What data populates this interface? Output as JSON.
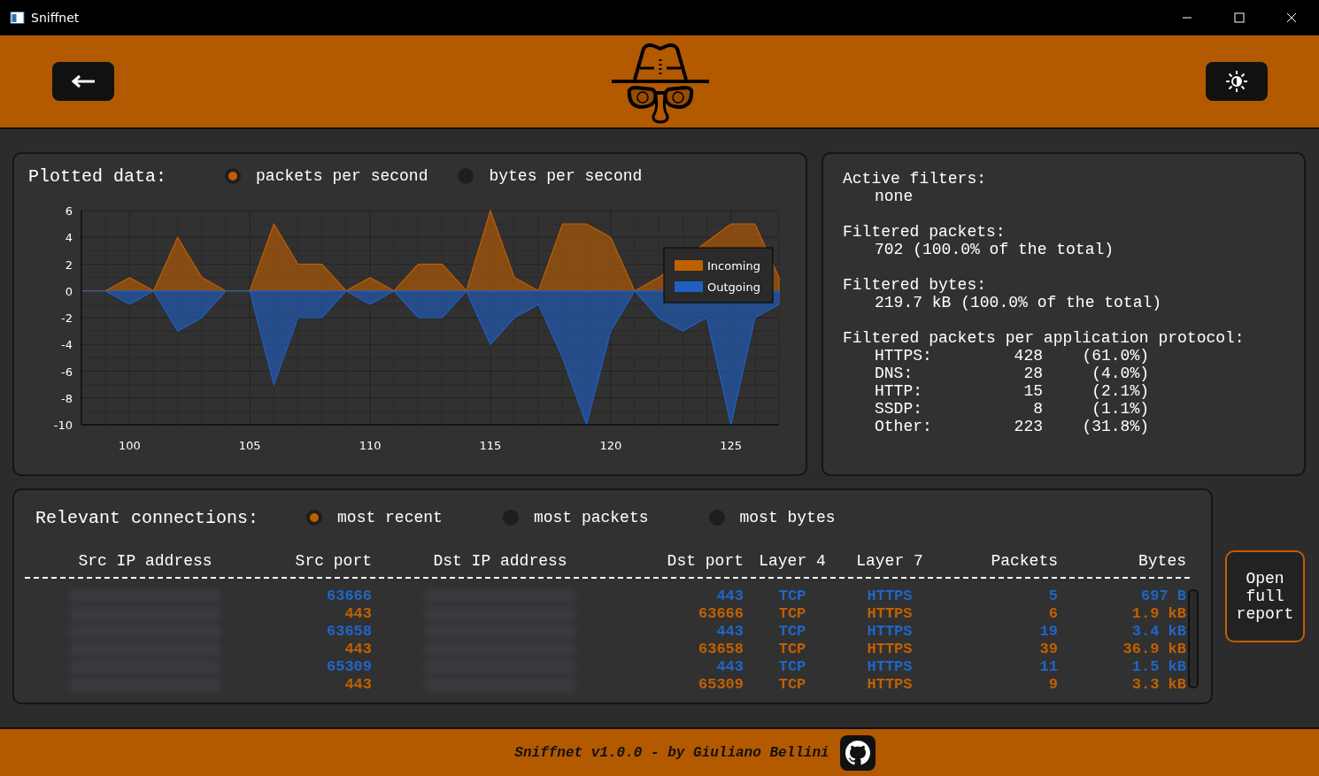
{
  "window": {
    "title": "Sniffnet"
  },
  "plot": {
    "title": "Plotted data:",
    "options": [
      {
        "label": "packets per second",
        "selected": true
      },
      {
        "label": "bytes per second",
        "selected": false
      }
    ],
    "chart_data": {
      "type": "area",
      "x": [
        98,
        99,
        100,
        101,
        102,
        103,
        104,
        105,
        106,
        107,
        108,
        109,
        110,
        111,
        112,
        113,
        114,
        115,
        116,
        117,
        118,
        119,
        120,
        121,
        122,
        123,
        124,
        125,
        126,
        127
      ],
      "series": [
        {
          "name": "Incoming",
          "color": "#c05f00",
          "values": [
            0,
            0,
            1,
            0,
            4,
            1,
            0,
            0,
            5,
            2,
            2,
            0,
            1,
            0,
            2,
            2,
            0,
            6,
            1,
            0,
            5,
            5,
            4,
            0,
            1,
            null,
            null,
            5,
            5,
            1
          ]
        },
        {
          "name": "Outgoing",
          "color": "#1f5fc4",
          "values": [
            0,
            0,
            -1,
            0,
            -3,
            -2,
            0,
            0,
            -7,
            -2,
            -2,
            0,
            -1,
            0,
            -2,
            -2,
            0,
            -4,
            -2,
            -1,
            -5,
            -10,
            -3,
            0,
            -2,
            -3,
            -2,
            -10,
            -2,
            -1
          ]
        }
      ],
      "xlim": [
        98,
        127
      ],
      "ylim": [
        -10,
        6
      ],
      "xticks": [
        100,
        105,
        110,
        115,
        120,
        125
      ],
      "yticks": [
        -10,
        -8,
        -6,
        -4,
        -2,
        0,
        2,
        4,
        6
      ],
      "grid": true,
      "legend": true
    }
  },
  "stats": {
    "filters_label": "Active filters:",
    "filters_value": "none",
    "packets_label": "Filtered packets:",
    "packets_value": "702 (100.0% of the total)",
    "bytes_label": "Filtered bytes:",
    "bytes_value": "219.7 kB (100.0% of the total)",
    "protocols_label": "Filtered packets per application protocol:",
    "protocols": [
      {
        "name": "HTTPS:",
        "count": "428",
        "share": "(61.0%)"
      },
      {
        "name": "DNS:",
        "count": "28",
        "share": "(4.0%)"
      },
      {
        "name": "HTTP:",
        "count": "15",
        "share": "(2.1%)"
      },
      {
        "name": "SSDP:",
        "count": "8",
        "share": "(1.1%)"
      },
      {
        "name": "Other:",
        "count": "223",
        "share": "(31.8%)"
      }
    ]
  },
  "connections": {
    "title": "Relevant connections:",
    "options": [
      {
        "label": "most recent",
        "selected": true
      },
      {
        "label": "most packets",
        "selected": false
      },
      {
        "label": "most bytes",
        "selected": false
      }
    ],
    "columns": [
      "Src IP address",
      "Src port",
      "Dst IP address",
      "Dst port",
      "Layer 4",
      "Layer 7",
      "Packets",
      "Bytes"
    ],
    "rows": [
      {
        "kind": "outgoing",
        "src_port": "63666",
        "dst_port": "443",
        "layer4": "TCP",
        "layer7": "HTTPS",
        "packets": "5",
        "bytes": "697 B"
      },
      {
        "kind": "incoming",
        "src_port": "443",
        "dst_port": "63666",
        "layer4": "TCP",
        "layer7": "HTTPS",
        "packets": "6",
        "bytes": "1.9 kB"
      },
      {
        "kind": "outgoing",
        "src_port": "63658",
        "dst_port": "443",
        "layer4": "TCP",
        "layer7": "HTTPS",
        "packets": "19",
        "bytes": "3.4 kB"
      },
      {
        "kind": "incoming",
        "src_port": "443",
        "dst_port": "63658",
        "layer4": "TCP",
        "layer7": "HTTPS",
        "packets": "39",
        "bytes": "36.9 kB"
      },
      {
        "kind": "outgoing",
        "src_port": "65309",
        "dst_port": "443",
        "layer4": "TCP",
        "layer7": "HTTPS",
        "packets": "11",
        "bytes": "1.5 kB"
      },
      {
        "kind": "incoming",
        "src_port": "443",
        "dst_port": "65309",
        "layer4": "TCP",
        "layer7": "HTTPS",
        "packets": "9",
        "bytes": "3.3 kB"
      }
    ]
  },
  "report_button": "Open full report",
  "footer": {
    "text": "Sniffnet v1.0.0 - by Giuliano Bellini"
  }
}
